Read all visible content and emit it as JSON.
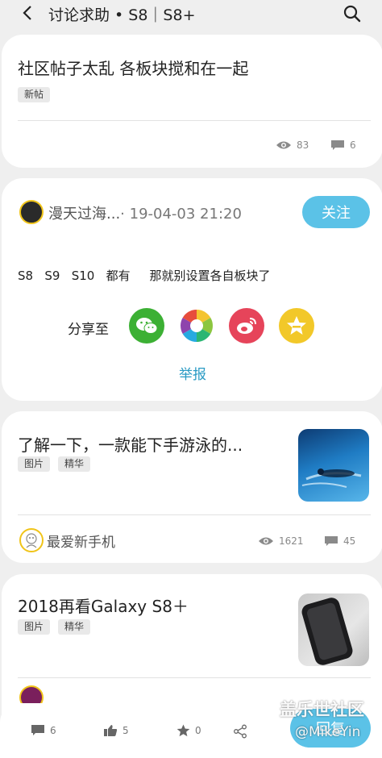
{
  "header": {
    "title": "讨论求助 • S8｜S8+"
  },
  "post1": {
    "title": "社区帖子太乱 各板块搅和在一起",
    "tag": "新帖",
    "views": "83",
    "comments": "6"
  },
  "post_detail": {
    "username": "漫天过海...",
    "datetime": "· 19-04-03 21:20",
    "follow_label": "关注",
    "body": "S8   S9   S10   都有     那就别设置各自板块了",
    "share_label": "分享至",
    "report_label": "举报",
    "share_icons": [
      "wechat-icon",
      "moments-icon",
      "weibo-icon",
      "qzone-icon"
    ]
  },
  "post3": {
    "title": "了解一下，一款能下手游泳的...",
    "tags": [
      "图片",
      "精华"
    ],
    "author": "最爱新手机",
    "views": "1621",
    "comments": "45"
  },
  "post4": {
    "title": "2018再看Galaxy S8＋",
    "tags": [
      "图片",
      "精华"
    ]
  },
  "bottom_bar": {
    "comments": "6",
    "likes": "5",
    "favorites": "0",
    "reply_label": "回复"
  },
  "watermark": {
    "line1": "盖乐世社区",
    "line2": "@MikeYin"
  },
  "colors": {
    "accent": "#5bc2e7",
    "report_link": "#2a9bc4",
    "wechat": "#3cb034",
    "weibo": "#e6445a",
    "qzone": "#f2c829"
  }
}
